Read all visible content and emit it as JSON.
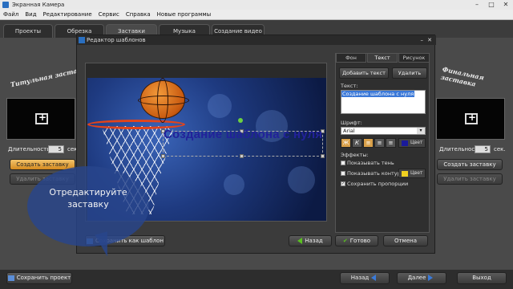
{
  "window": {
    "title": "Экранная Камера"
  },
  "menu": [
    "Файл",
    "Вид",
    "Редактирование",
    "Сервис",
    "Справка",
    "Новые программы"
  ],
  "tabs": [
    "Проекты",
    "Обрезка",
    "Заставки",
    "Музыка",
    "Создание видео"
  ],
  "left": {
    "title": "Титульная заставка",
    "duration_label": "Длительность:",
    "duration_value": "5",
    "sec": "сек.",
    "create": "Создать заставку",
    "delete": "Удалить заставку"
  },
  "right": {
    "title": "Финальная заставка",
    "duration_label": "Длительность:",
    "duration_value": "5",
    "sec": "сек.",
    "create": "Создать заставку",
    "delete": "Удалить заставку"
  },
  "dialog": {
    "title": "Редактор шаблонов",
    "canvas_text": "Создание шаблона с нуля",
    "panel_tabs": [
      "Фон",
      "Текст",
      "Рисунок"
    ],
    "add_text": "Добавить текст",
    "remove": "Удалить",
    "text_label": "Текст:",
    "text_value": "Создание шаблона с нуля",
    "font_label": "Шрифт:",
    "font_value": "Arial",
    "color_label": "Цвет",
    "effects_label": "Эффекты:",
    "shadow": "Показывать тень",
    "outline": "Показывать контур",
    "outline_color": "Цвет",
    "keep_ratio": "Сохранить пропорции",
    "save_template": "Сохранить как шаблон",
    "back": "Назад",
    "done": "Готово",
    "cancel": "Отмена",
    "text_color": "#1a1a9a",
    "outline_swatch": "#f0d020"
  },
  "bottom": {
    "save_project": "Сохранить проект",
    "back": "Назад",
    "next": "Далее",
    "exit": "Выход"
  },
  "bubble": {
    "text": "Отредактируйте заставку"
  }
}
